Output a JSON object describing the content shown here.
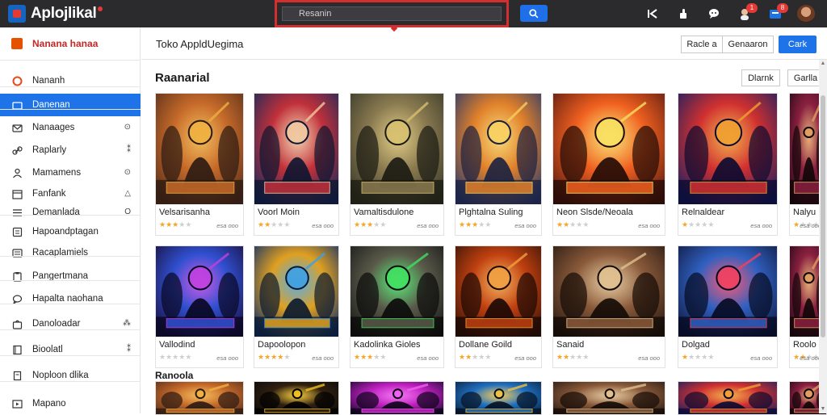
{
  "app": {
    "title": "Aplojlikal",
    "badge_count_1": "1",
    "badge_count_2": "8"
  },
  "search": {
    "placeholder": "Resanin",
    "value": ""
  },
  "sidebar": {
    "header": "Nanana hanaa",
    "items": [
      {
        "label": "Nananh",
        "icon": "circle-icon",
        "trail": ""
      },
      {
        "label": "Danenan",
        "icon": "folder-icon",
        "trail": "",
        "active": true
      },
      {
        "label": "Nanaages",
        "icon": "mail-icon",
        "trail": "⊙"
      },
      {
        "label": "Raplarly",
        "icon": "link-icon",
        "trail": "⁑"
      },
      {
        "label": "Mamamens",
        "icon": "person-icon",
        "trail": "⊙"
      },
      {
        "label": "Fanfank",
        "icon": "calendar-icon",
        "trail": "△"
      },
      {
        "label": "Demanlada",
        "icon": "list-icon",
        "trail": "O"
      },
      {
        "label": "Hapoandptagan",
        "icon": "apps-icon",
        "trail": ""
      },
      {
        "label": "Racaplamiels",
        "icon": "person-list-icon",
        "trail": ""
      },
      {
        "label": "Pangertmana",
        "icon": "clipboard-icon",
        "trail": ""
      },
      {
        "label": "Hapalta naohana",
        "icon": "chat-icon",
        "trail": ""
      },
      {
        "label": "Danoloadar",
        "icon": "bag-icon",
        "trail": "⁂"
      },
      {
        "label": "Bioolatl",
        "icon": "book-icon",
        "trail": "⁑"
      },
      {
        "label": "Noploon dlika",
        "icon": "page-icon",
        "trail": ""
      },
      {
        "label": "Mapano",
        "icon": "play-icon",
        "trail": ""
      }
    ]
  },
  "main": {
    "title": "Toko AppldUegima",
    "header_buttons": [
      "Racle a",
      "Genaaron",
      "Cark"
    ],
    "section1_title": "Raanarial",
    "section1_buttons": [
      "Dlarnk",
      "Garlla"
    ],
    "section2_title": "Ranoola",
    "row1": [
      {
        "name": "Velsarisanha",
        "stars": 3,
        "price": "esa ooo",
        "art": "warrior"
      },
      {
        "name": "Voorl Moin",
        "stars": 2,
        "price": "esa ooo",
        "art": "redhair"
      },
      {
        "name": "Vamaltisdulone",
        "stars": 3,
        "price": "esa ooo",
        "art": "armor"
      },
      {
        "name": "Plghtalna Suling",
        "stars": 3,
        "price": "esa ooo",
        "art": "group"
      },
      {
        "name": "Neon Slsde/Neoala",
        "stars": 2,
        "price": "esa ooo",
        "art": "action"
      },
      {
        "name": "Relnaldear",
        "stars": 1,
        "price": "esa ooo",
        "art": "heroes"
      },
      {
        "name": "Nalyu",
        "stars": 1,
        "price": "esa ooo",
        "art": "dark"
      }
    ],
    "row2": [
      {
        "name": "Vallodind",
        "stars": 0,
        "price": "esa ooo",
        "art": "mage"
      },
      {
        "name": "Dapoolopon",
        "stars": 4,
        "price": "esa ooo",
        "art": "fighters"
      },
      {
        "name": "Kadolinka Gioles",
        "stars": 3,
        "price": "esa ooo",
        "art": "soldiers"
      },
      {
        "name": "Dollane Goild",
        "stars": 2,
        "price": "esa ooo",
        "art": "dragon"
      },
      {
        "name": "Sanaid",
        "stars": 2,
        "price": "esa ooo",
        "art": "knight"
      },
      {
        "name": "Dolgad",
        "stars": 1,
        "price": "esa ooo",
        "art": "rogue"
      },
      {
        "name": "Roolo",
        "stars": 2,
        "price": "esa ooo",
        "art": "dark"
      }
    ],
    "row3": [
      {
        "art": "warrior"
      },
      {
        "art": "title"
      },
      {
        "art": "neon"
      },
      {
        "art": "wizard"
      },
      {
        "art": "knight"
      },
      {
        "art": "heroes"
      },
      {
        "art": "dark"
      }
    ]
  },
  "colors": {
    "accent": "#1e73e8",
    "topbar": "#2b2b2e",
    "highlight": "#d32f2f",
    "star": "#f5a623"
  }
}
